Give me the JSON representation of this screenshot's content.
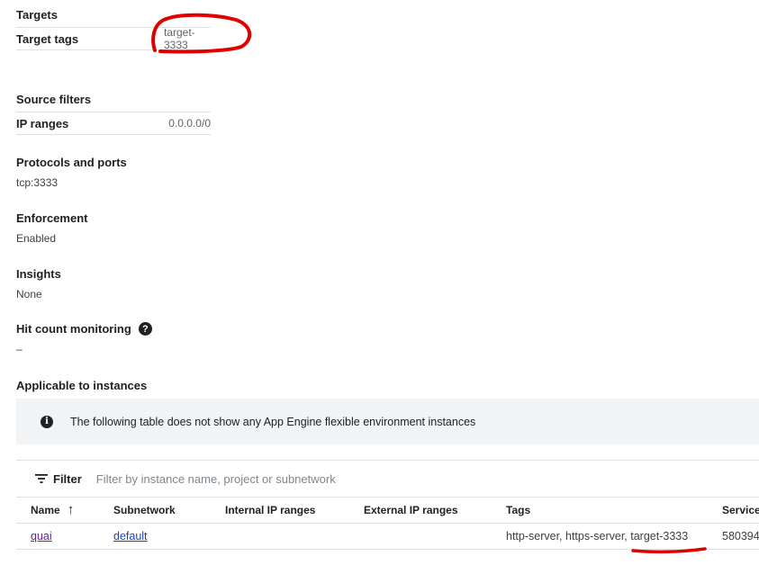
{
  "targets": {
    "heading": "Targets",
    "tags_label": "Target tags",
    "tags_value": "target-3333"
  },
  "source_filters": {
    "heading": "Source filters",
    "ip_ranges_label": "IP ranges",
    "ip_ranges_value": "0.0.0.0/0"
  },
  "protocols": {
    "heading": "Protocols and ports",
    "value": "tcp:3333"
  },
  "enforcement": {
    "heading": "Enforcement",
    "value": "Enabled"
  },
  "insights": {
    "heading": "Insights",
    "value": "None"
  },
  "hit_count": {
    "heading": "Hit count monitoring",
    "help_glyph": "?",
    "value": "–"
  },
  "applicable": {
    "heading": "Applicable to instances",
    "banner_glyph": "i",
    "banner_text": "The following table does not show any App Engine flexible environment instances"
  },
  "filter": {
    "label": "Filter",
    "placeholder": "Filter by instance name, project or subnetwork"
  },
  "table": {
    "columns": {
      "name": "Name",
      "subnetwork": "Subnetwork",
      "internal_ip": "Internal IP ranges",
      "external_ip": "External IP ranges",
      "tags": "Tags",
      "service": "Service"
    },
    "sort_glyph": "↑",
    "rows": [
      {
        "name": "quai",
        "subnetwork": "default",
        "internal_ip": "",
        "external_ip": "",
        "tags": "http-server, https-server, target-3333",
        "service": "580394"
      }
    ]
  },
  "icons": {
    "help": "help-circle-icon",
    "info": "info-circle-icon",
    "filter": "filter-list-icon",
    "sort": "arrow-up-icon"
  },
  "colors": {
    "annotation": "#e00000",
    "link": "#1a3ec2",
    "visited_link": "#681da8",
    "banner_bg": "#f1f3f4"
  }
}
